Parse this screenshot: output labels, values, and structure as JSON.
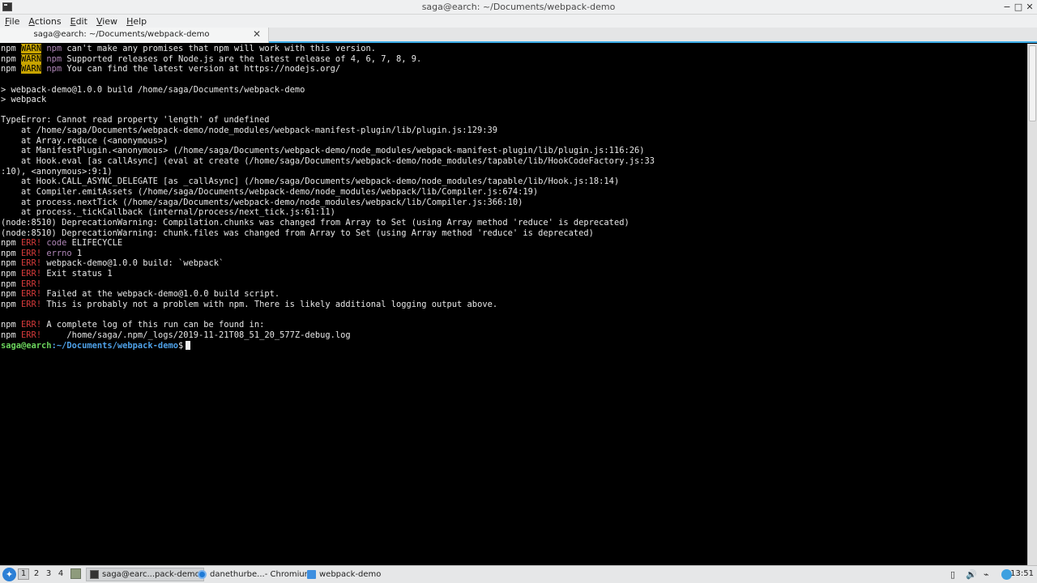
{
  "window": {
    "title": "saga@earch: ~/Documents/webpack-demo",
    "controls": {
      "minimize": "−",
      "maximize": "□",
      "close": "✕"
    }
  },
  "menubar": {
    "file": {
      "ul": "F",
      "rest": "ile"
    },
    "actions": {
      "ul": "A",
      "rest": "ctions"
    },
    "edit": {
      "ul": "E",
      "rest": "dit"
    },
    "view": {
      "ul": "V",
      "rest": "iew"
    },
    "help": {
      "ul": "H",
      "rest": "elp"
    }
  },
  "tab": {
    "label": "saga@earch: ~/Documents/webpack-demo",
    "close": "✕"
  },
  "terminal": {
    "npm": "npm",
    "warn_tag": "WARN",
    "err_tag": "ERR!",
    "warn_lines": [
      " can't make any promises that npm will work with this version.",
      " Supported releases of Node.js are the latest release of 4, 6, 7, 8, 9.",
      " You can find the latest version at https://nodejs.org/"
    ],
    "plain_lines": [
      "",
      "> webpack-demo@1.0.0 build /home/saga/Documents/webpack-demo",
      "> webpack",
      "",
      "TypeError: Cannot read property 'length' of undefined",
      "    at /home/saga/Documents/webpack-demo/node_modules/webpack-manifest-plugin/lib/plugin.js:129:39",
      "    at Array.reduce (<anonymous>)",
      "    at ManifestPlugin.<anonymous> (/home/saga/Documents/webpack-demo/node_modules/webpack-manifest-plugin/lib/plugin.js:116:26)",
      "    at Hook.eval [as callAsync] (eval at create (/home/saga/Documents/webpack-demo/node_modules/tapable/lib/HookCodeFactory.js:33",
      ":10), <anonymous>:9:1)",
      "    at Hook.CALL_ASYNC_DELEGATE [as _callAsync] (/home/saga/Documents/webpack-demo/node_modules/tapable/lib/Hook.js:18:14)",
      "    at Compiler.emitAssets (/home/saga/Documents/webpack-demo/node_modules/webpack/lib/Compiler.js:674:19)",
      "    at process.nextTick (/home/saga/Documents/webpack-demo/node_modules/webpack/lib/Compiler.js:366:10)",
      "    at process._tickCallback (internal/process/next_tick.js:61:11)",
      "(node:8510) DeprecationWarning: Compilation.chunks was changed from Array to Set (using Array method 'reduce' is deprecated)",
      "(node:8510) DeprecationWarning: chunk.files was changed from Array to Set (using Array method 'reduce' is deprecated)"
    ],
    "err_lines": [
      {
        "dim": " code",
        "text": " ELIFECYCLE"
      },
      {
        "dim": " errno",
        "text": " 1"
      },
      {
        "dim": "",
        "text": " webpack-demo@1.0.0 build: `webpack`"
      },
      {
        "dim": "",
        "text": " Exit status 1"
      },
      {
        "dim": "",
        "text": ""
      },
      {
        "dim": "",
        "text": " Failed at the webpack-demo@1.0.0 build script."
      },
      {
        "dim": "",
        "text": " This is probably not a problem with npm. There is likely additional logging output above."
      }
    ],
    "err_lines2": [
      " A complete log of this run can be found in:",
      "     /home/saga/.npm/_logs/2019-11-21T08_51_20_577Z-debug.log"
    ],
    "prompt_user": "saga@earch",
    "prompt_path": ":~/Documents/webpack-demo",
    "prompt_symbol": "$"
  },
  "taskbar": {
    "start_icon": "start-menu-icon",
    "desktops": [
      "1",
      "2",
      "3",
      "4"
    ],
    "tasks": [
      {
        "label": "saga@earc...pack-demo",
        "icon": "terminal-icon"
      },
      {
        "label": "danethurbe...- Chromium",
        "icon": "chromium-icon"
      },
      {
        "label": "webpack-demo",
        "icon": "folder-icon"
      }
    ],
    "clock": "13:51",
    "tray_glyphs": {
      "battery": "▯",
      "volume": "🔊",
      "network": "⌁"
    }
  }
}
